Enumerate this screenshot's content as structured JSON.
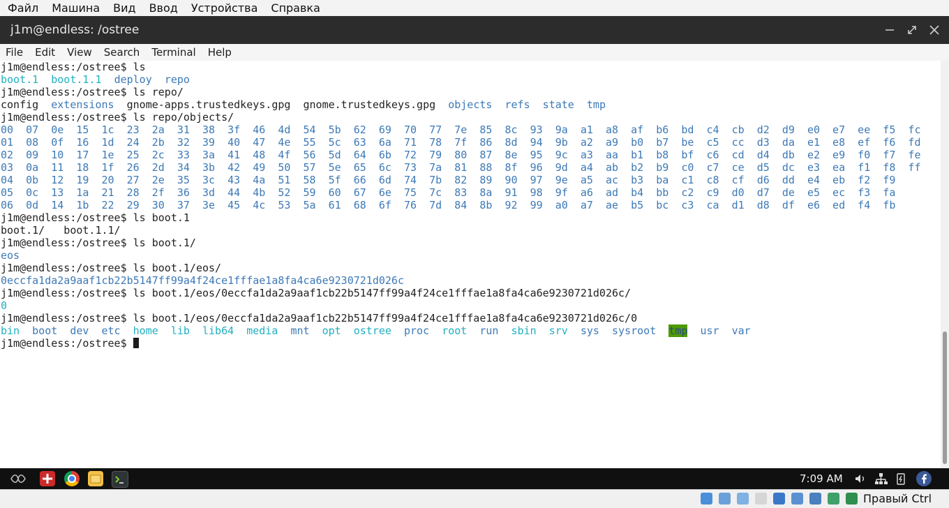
{
  "vbox_menu": [
    "Файл",
    "Машина",
    "Вид",
    "Ввод",
    "Устройства",
    "Справка"
  ],
  "window": {
    "title": "j1m@endless: /ostree"
  },
  "terminal_menu": [
    "File",
    "Edit",
    "View",
    "Search",
    "Terminal",
    "Help"
  ],
  "terminal_lines": [
    [
      {
        "t": "j1m@endless:/ostree$ ls"
      }
    ],
    [
      {
        "t": "boot.1",
        "c": "cyan"
      },
      {
        "t": "  "
      },
      {
        "t": "boot.1.1",
        "c": "cyan"
      },
      {
        "t": "  "
      },
      {
        "t": "deploy",
        "c": "dir"
      },
      {
        "t": "  "
      },
      {
        "t": "repo",
        "c": "dir"
      }
    ],
    [
      {
        "t": "j1m@endless:/ostree$ ls repo/"
      }
    ],
    [
      {
        "t": "config  "
      },
      {
        "t": "extensions",
        "c": "dir"
      },
      {
        "t": "  gnome-apps.trustedkeys.gpg  gnome.trustedkeys.gpg  "
      },
      {
        "t": "objects",
        "c": "dir"
      },
      {
        "t": "  "
      },
      {
        "t": "refs",
        "c": "dir"
      },
      {
        "t": "  "
      },
      {
        "t": "state",
        "c": "dir"
      },
      {
        "t": "  "
      },
      {
        "t": "tmp",
        "c": "dir"
      }
    ],
    [
      {
        "t": "j1m@endless:/ostree$ ls repo/objects/"
      }
    ],
    [
      {
        "t": "00  07  0e  15  1c  23  2a  31  38  3f  46  4d  54  5b  62  69  70  77  7e  85  8c  93  9a  a1  a8  af  b6  bd  c4  cb  d2  d9  e0  e7  ee  f5  fc",
        "c": "dir"
      }
    ],
    [
      {
        "t": "01  08  0f  16  1d  24  2b  32  39  40  47  4e  55  5c  63  6a  71  78  7f  86  8d  94  9b  a2  a9  b0  b7  be  c5  cc  d3  da  e1  e8  ef  f6  fd",
        "c": "dir"
      }
    ],
    [
      {
        "t": "02  09  10  17  1e  25  2c  33  3a  41  48  4f  56  5d  64  6b  72  79  80  87  8e  95  9c  a3  aa  b1  b8  bf  c6  cd  d4  db  e2  e9  f0  f7  fe",
        "c": "dir"
      }
    ],
    [
      {
        "t": "03  0a  11  18  1f  26  2d  34  3b  42  49  50  57  5e  65  6c  73  7a  81  88  8f  96  9d  a4  ab  b2  b9  c0  c7  ce  d5  dc  e3  ea  f1  f8  ff",
        "c": "dir"
      }
    ],
    [
      {
        "t": "04  0b  12  19  20  27  2e  35  3c  43  4a  51  58  5f  66  6d  74  7b  82  89  90  97  9e  a5  ac  b3  ba  c1  c8  cf  d6  dd  e4  eb  f2  f9",
        "c": "dir"
      }
    ],
    [
      {
        "t": "05  0c  13  1a  21  28  2f  36  3d  44  4b  52  59  60  67  6e  75  7c  83  8a  91  98  9f  a6  ad  b4  bb  c2  c9  d0  d7  de  e5  ec  f3  fa",
        "c": "dir"
      }
    ],
    [
      {
        "t": "06  0d  14  1b  22  29  30  37  3e  45  4c  53  5a  61  68  6f  76  7d  84  8b  92  99  a0  a7  ae  b5  bc  c3  ca  d1  d8  df  e6  ed  f4  fb",
        "c": "dir"
      }
    ],
    [
      {
        "t": "j1m@endless:/ostree$ ls boot.1"
      }
    ],
    [
      {
        "t": "boot.1/   boot.1.1/"
      }
    ],
    [
      {
        "t": "j1m@endless:/ostree$ ls boot.1/"
      }
    ],
    [
      {
        "t": "eos",
        "c": "dir"
      }
    ],
    [
      {
        "t": "j1m@endless:/ostree$ ls boot.1/eos/"
      }
    ],
    [
      {
        "t": "0eccfa1da2a9aaf1cb22b5147ff99a4f24ce1fffae1a8fa4ca6e9230721d026c",
        "c": "dir"
      }
    ],
    [
      {
        "t": "j1m@endless:/ostree$ ls boot.1/eos/0eccfa1da2a9aaf1cb22b5147ff99a4f24ce1fffae1a8fa4ca6e9230721d026c/"
      }
    ],
    [
      {
        "t": "0",
        "c": "cyan"
      }
    ],
    [
      {
        "t": "j1m@endless:/ostree$ ls boot.1/eos/0eccfa1da2a9aaf1cb22b5147ff99a4f24ce1fffae1a8fa4ca6e9230721d026c/0"
      }
    ],
    [
      {
        "t": "bin",
        "c": "cyan"
      },
      {
        "t": "  "
      },
      {
        "t": "boot",
        "c": "dir"
      },
      {
        "t": "  "
      },
      {
        "t": "dev",
        "c": "dir"
      },
      {
        "t": "  "
      },
      {
        "t": "etc",
        "c": "dir"
      },
      {
        "t": "  "
      },
      {
        "t": "home",
        "c": "cyan"
      },
      {
        "t": "  "
      },
      {
        "t": "lib",
        "c": "cyan"
      },
      {
        "t": "  "
      },
      {
        "t": "lib64",
        "c": "cyan"
      },
      {
        "t": "  "
      },
      {
        "t": "media",
        "c": "cyan"
      },
      {
        "t": "  "
      },
      {
        "t": "mnt",
        "c": "dir"
      },
      {
        "t": "  "
      },
      {
        "t": "opt",
        "c": "cyan"
      },
      {
        "t": "  "
      },
      {
        "t": "ostree",
        "c": "cyan"
      },
      {
        "t": "  "
      },
      {
        "t": "proc",
        "c": "dir"
      },
      {
        "t": "  "
      },
      {
        "t": "root",
        "c": "cyan"
      },
      {
        "t": "  "
      },
      {
        "t": "run",
        "c": "dir"
      },
      {
        "t": "  "
      },
      {
        "t": "sbin",
        "c": "cyan"
      },
      {
        "t": "  "
      },
      {
        "t": "srv",
        "c": "cyan"
      },
      {
        "t": "  "
      },
      {
        "t": "sys",
        "c": "dir"
      },
      {
        "t": "  "
      },
      {
        "t": "sysroot",
        "c": "dir"
      },
      {
        "t": "  "
      },
      {
        "t": "tmp",
        "c": "tmpdir"
      },
      {
        "t": "  "
      },
      {
        "t": "usr",
        "c": "dir"
      },
      {
        "t": "  "
      },
      {
        "t": "var",
        "c": "dir"
      }
    ],
    [
      {
        "t": "j1m@endless:/ostree$ "
      },
      {
        "cursor": true
      }
    ]
  ],
  "taskbar": {
    "clock": "7:09 AM"
  },
  "vbox_status": {
    "host_key": "Правый Ctrl"
  },
  "colors": {
    "dir": "#3d79b6",
    "cyan": "#1fb0c0",
    "tmp_bg": "#4e9a06"
  }
}
